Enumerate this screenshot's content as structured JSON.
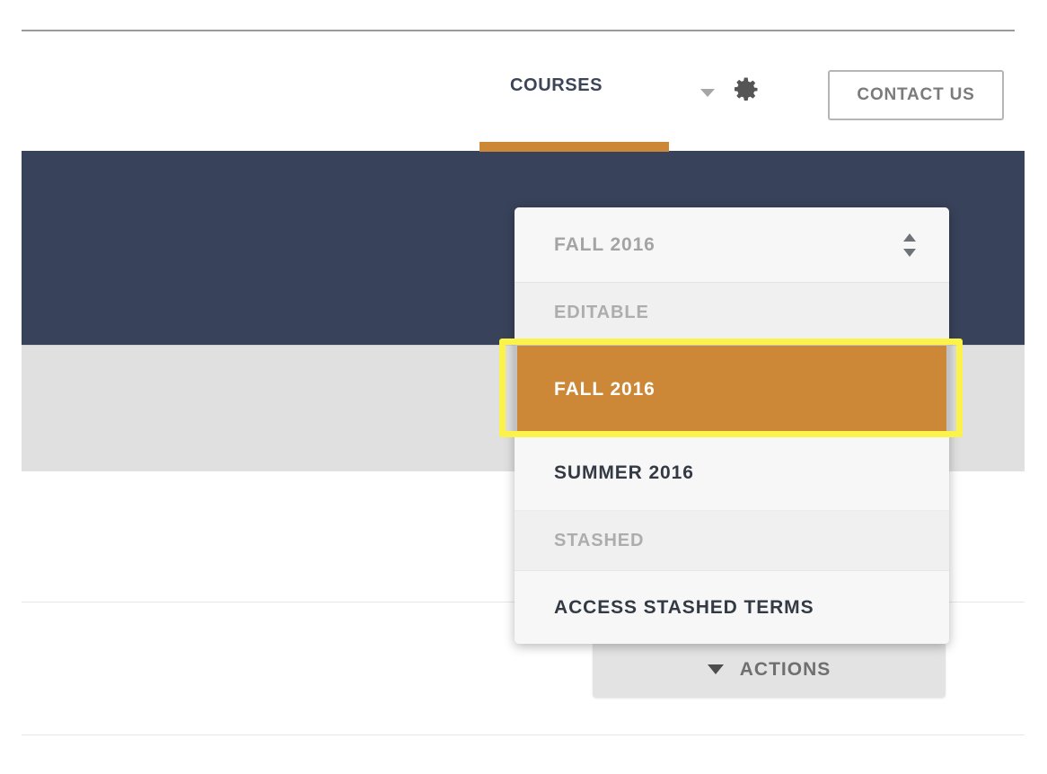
{
  "header": {
    "nav_link": "COURSES",
    "settings_caret_icon": "chevron-down-icon",
    "settings_gear_icon": "gear-icon",
    "contact_button": "CONTACT US",
    "active_tab_color": "#cd8837"
  },
  "bands": {
    "navy_color": "#38425a",
    "gray_color": "#e0e0e0"
  },
  "term_dropdown": {
    "select_value": "FALL 2016",
    "sort_icon": "sort-updown-icon",
    "groups": [
      {
        "label": "EDITABLE",
        "options": [
          {
            "label": "FALL 2016",
            "selected": true
          },
          {
            "label": "SUMMER 2016",
            "selected": false
          }
        ]
      },
      {
        "label": "STASHED",
        "options": [
          {
            "label": "ACCESS STASHED TERMS",
            "selected": false
          }
        ]
      }
    ],
    "highlight_color": "#fbf24a",
    "selected_background": "#cd8837"
  },
  "actions": {
    "caret_icon": "caret-down-icon",
    "label": "ACTIONS"
  }
}
